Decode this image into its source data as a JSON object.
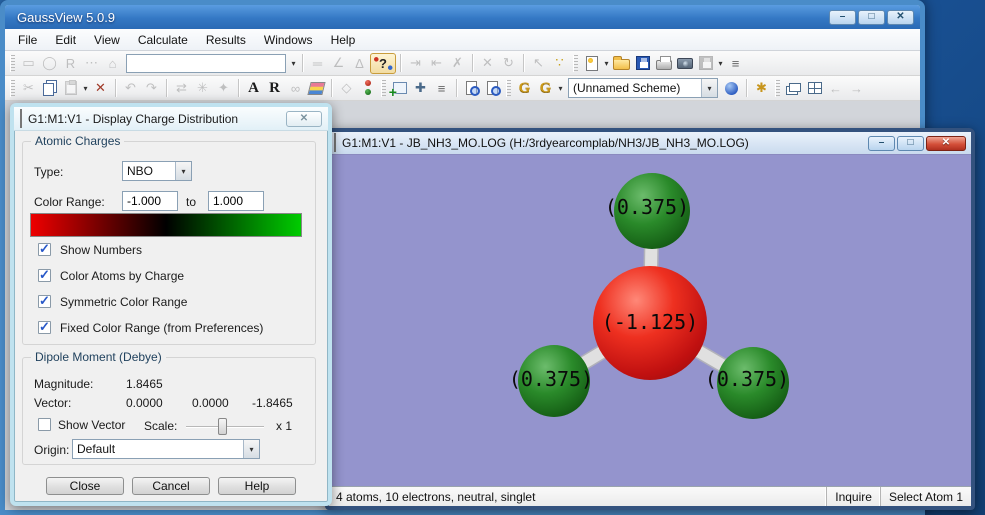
{
  "main_window": {
    "title": "GaussView 5.0.9",
    "menu": [
      "File",
      "Edit",
      "View",
      "Calculate",
      "Results",
      "Windows",
      "Help"
    ],
    "builder_combo_value": "",
    "scheme_combo_value": "(Unnamed Scheme)"
  },
  "charge_dialog": {
    "title": "G1:M1:V1 - Display Charge Distribution",
    "atomic_charges": {
      "group_label": "Atomic Charges",
      "type_label": "Type:",
      "type_value": "NBO",
      "color_range_label": "Color Range:",
      "range_min": "-1.000",
      "to_label": "to",
      "range_max": "1.000",
      "gradient_negative_color": "#ee0000",
      "gradient_positive_color": "#00cc00",
      "checkboxes": [
        {
          "label": "Show Numbers",
          "checked": true
        },
        {
          "label": "Color Atoms by Charge",
          "checked": true
        },
        {
          "label": "Symmetric Color Range",
          "checked": true
        },
        {
          "label": "Fixed Color Range (from Preferences)",
          "checked": true
        }
      ]
    },
    "dipole": {
      "group_label": "Dipole Moment (Debye)",
      "magnitude_label": "Magnitude:",
      "magnitude": "1.8465",
      "vector_label": "Vector:",
      "vector": [
        "0.0000",
        "0.0000",
        "-1.8465"
      ],
      "show_vector": {
        "label": "Show Vector",
        "checked": false
      },
      "scale_label": "Scale:",
      "scale_value": "x 1",
      "origin_label": "Origin:",
      "origin_value": "Default"
    },
    "buttons": [
      "Close",
      "Cancel",
      "Help"
    ]
  },
  "molecule_window": {
    "title": "G1:M1:V1 - JB_NH3_MO.LOG (H:/3rdyearcomplab/NH3/JB_NH3_MO.LOG)",
    "viewport_bg": "#9494cd",
    "atoms": [
      {
        "element": "N",
        "charge": "(-1.125)",
        "color": "#cc1a1a"
      },
      {
        "element": "H",
        "charge": "(0.375)",
        "color": "#1b7a1b"
      },
      {
        "element": "H",
        "charge": "(0.375)",
        "color": "#1b7a1b"
      },
      {
        "element": "H",
        "charge": "(0.375)",
        "color": "#1b7a1b"
      }
    ],
    "status_left": "4 atoms, 10 electrons, neutral, singlet",
    "status_right": [
      "Inquire",
      "Select Atom 1"
    ]
  },
  "icons": {
    "caret": {
      "glyph": "▾",
      "color": "#333333"
    },
    "win-minimize": {
      "glyph": "–"
    },
    "win-maximize": {
      "glyph": "□"
    },
    "win-close": {
      "glyph": "✕"
    },
    "gaussview-logo": {
      "cls": "ic-logo"
    },
    "molecule-doc": {
      "cls": "ic-moldoc"
    },
    "place-fragment": {
      "glyph": "▭",
      "enabled": false
    },
    "ring-fragment": {
      "glyph": "◯",
      "enabled": false
    },
    "r-group-fragment": {
      "glyph": "R",
      "enabled": false
    },
    "chain-fragment": {
      "glyph": "⋯",
      "enabled": false
    },
    "build-fragment": {
      "glyph": "⌂",
      "enabled": false
    },
    "bond-tool": {
      "glyph": "═",
      "enabled": false
    },
    "angle-tool": {
      "glyph": "∠",
      "enabled": false
    },
    "dihedral-tool": {
      "glyph": "∆",
      "enabled": false
    },
    "element-fragment": {
      "glyph": "?",
      "cls": "t-qmark"
    },
    "add-valence": {
      "glyph": "⇥",
      "enabled": false
    },
    "remove-valence": {
      "glyph": "⇤",
      "enabled": false
    },
    "delete-fragment": {
      "glyph": "✗",
      "enabled": false
    },
    "invert-selection": {
      "glyph": "✕",
      "enabled": false
    },
    "rebond": {
      "glyph": "↻",
      "enabled": false
    },
    "select-tool": {
      "glyph": "↖",
      "enabled": false
    },
    "atom-selection": {
      "glyph": "∵",
      "color": "#c8a018"
    },
    "new-file": {
      "cls": "ic-page"
    },
    "open-file": {
      "cls": "ic-folder"
    },
    "save-file": {
      "cls": "ic-disk"
    },
    "print-file": {
      "cls": "ic-printer"
    },
    "capture-image": {
      "cls": "ic-camera"
    },
    "save-all": {
      "cls": "ic-disk",
      "enabled": false
    },
    "item-list": {
      "glyph": "≡",
      "color": "#666666"
    },
    "cut": {
      "glyph": "✂",
      "enabled": false
    },
    "copy": {
      "cls": "ic-copy"
    },
    "paste": {
      "cls": "ic-clip",
      "enabled": false
    },
    "delete": {
      "glyph": "✕",
      "color": "#a03a28"
    },
    "undo": {
      "glyph": "↶",
      "enabled": false
    },
    "redo": {
      "glyph": "↷",
      "enabled": false
    },
    "mirror": {
      "glyph": "⇄",
      "enabled": false
    },
    "clean-structure": {
      "glyph": "✳",
      "enabled": false
    },
    "symmetrize": {
      "glyph": "✦",
      "enabled": false
    },
    "add-text": {
      "glyph": "A",
      "cls": "serifb"
    },
    "add-formula": {
      "glyph": "R",
      "cls": "serifb"
    },
    "link-fragment": {
      "glyph": "∞",
      "enabled": false
    },
    "layers": {
      "cls": "ic-layers"
    },
    "measure": {
      "glyph": "◇",
      "enabled": false
    },
    "atom-properties": {
      "cls": "ic-dots2"
    },
    "add-view": {
      "cls": "ic-addview"
    },
    "recenter": {
      "glyph": "✚",
      "color": "#4a6a8a"
    },
    "sequence-list": {
      "glyph": "≡",
      "color": "#666666"
    },
    "log-viewer": {
      "cls": "ic-docmag"
    },
    "output-viewer": {
      "cls": "ic-docmag"
    },
    "gaussian-calculate": {
      "glyph": "G",
      "cls": "g-gold"
    },
    "gaussian-quicklaunch": {
      "glyph": "G",
      "cls": "g-gold"
    },
    "scheme-edit": {
      "cls": "ic-sphere"
    },
    "preferences": {
      "glyph": "✱",
      "color": "#c8961e"
    },
    "cascade-windows": {
      "cls": "ic-cascade"
    },
    "tile-windows": {
      "cls": "ic-tile"
    },
    "nav-back": {
      "glyph": "←",
      "enabled": false
    },
    "nav-forward": {
      "glyph": "→",
      "enabled": false
    }
  }
}
